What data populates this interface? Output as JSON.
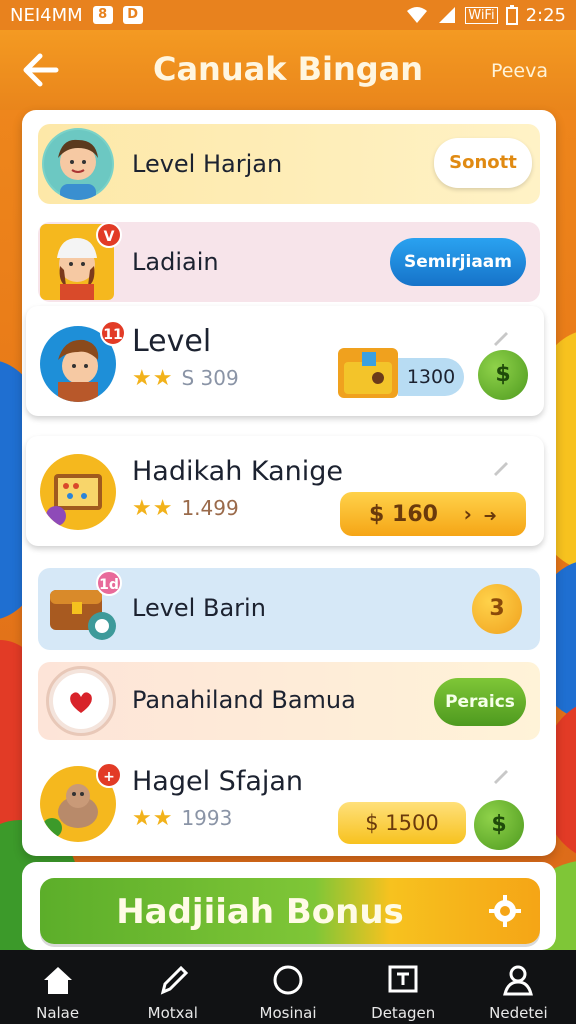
{
  "status_bar": {
    "left_text": "NEI4MM",
    "badge1": "8",
    "badge2": "D",
    "wifi_text": "WiFi",
    "right_text": "2:25"
  },
  "header": {
    "title": "Canuak Bingan",
    "right_label": "Peeva"
  },
  "rows": [
    {
      "label": "Level Harjan",
      "button": "Sonott"
    },
    {
      "label": "Ladiain",
      "button": "Semirjiaam",
      "badge": "V"
    },
    {
      "label": "Level",
      "stars": "★★",
      "count": "S 309",
      "price": "1300",
      "coin": "$",
      "badge": "11"
    },
    {
      "label": "Hadikah Kanige",
      "stars": "★★",
      "count": "1.499",
      "price": "$ 160",
      "price_arrow": "›",
      "arrow2": "➜"
    },
    {
      "label": "Level Barin",
      "coin": "3",
      "badge": "1d"
    },
    {
      "label": "Panahiland Bamua",
      "button": "Peraics"
    },
    {
      "label": "Hagel Sfajan",
      "stars": "★★",
      "count": "1993",
      "price": "$ 1500",
      "coin": "$",
      "badge": "+"
    }
  ],
  "bonus": {
    "label": "Hadjiiah Bonus"
  },
  "nav": [
    {
      "label": "Nalae",
      "icon": "home-icon"
    },
    {
      "label": "Motxal",
      "icon": "pencil-icon"
    },
    {
      "label": "Mosinai",
      "icon": "circle-icon"
    },
    {
      "label": "Detagen",
      "icon": "tv-icon"
    },
    {
      "label": "Nedetei",
      "icon": "person-icon"
    }
  ],
  "colors": {
    "accent": "#e8821e",
    "green": "#5cae2a",
    "blue": "#1c8fe0",
    "gold": "#f7c21f"
  }
}
